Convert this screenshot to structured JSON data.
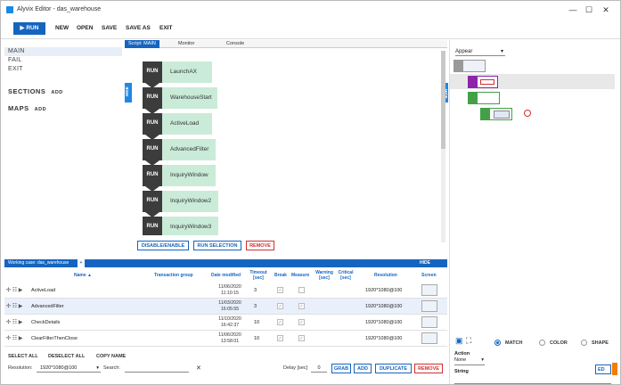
{
  "window": {
    "title": "Alyvix Editor - das_warehouse",
    "controls": [
      "—",
      "☐",
      "✕"
    ]
  },
  "toolbar": {
    "run": "RUN",
    "new": "NEW",
    "open": "OPEN",
    "save": "SAVE",
    "save_as": "SAVE AS",
    "exit": "EXIT"
  },
  "nav": {
    "items": [
      "MAIN",
      "FAIL",
      "EXIT"
    ],
    "sections": "SECTIONS",
    "maps": "MAPS",
    "add": "ADD"
  },
  "center": {
    "tabs": [
      "Script: MAIN",
      "Monitor",
      "Console"
    ],
    "hide": "HIDE",
    "run": "RUN",
    "steps": [
      "LaunchAX",
      "WarehouseStart",
      "ActiveLoad",
      "AdvancedFilter",
      "InquiryWindow",
      "InquiryWindow2",
      "InquiryWindow3"
    ],
    "buttons": {
      "disable_enable": "DISABLE/ENABLE",
      "run_selection": "RUN SELECTION",
      "remove": "REMOVE"
    }
  },
  "testcases": {
    "header_label": "Working case: das_warehouse",
    "plus": "+",
    "hide": "HIDE",
    "columns": {
      "name": "Name ▲",
      "group": "Transaction group",
      "modified": "Date modified",
      "timeout": "Timeout [sec]",
      "break": "Break",
      "measure": "Measure",
      "warning": "Warning [sec]",
      "critical": "Critical [sec]",
      "resolution": "Resolution",
      "screen": "Screen"
    },
    "rows": [
      {
        "name": "ActiveLoad",
        "date": "11/06/2020",
        "time": "11:10:15",
        "timeout": "3",
        "resolution": "1920*1080@100"
      },
      {
        "name": "AdvancedFilter",
        "date": "11/03/2020",
        "time": "16:05:55",
        "timeout": "3",
        "resolution": "1920*1080@100"
      },
      {
        "name": "CheckDetails",
        "date": "11/10/2020",
        "time": "16:42:37",
        "timeout": "10",
        "resolution": "1920*1080@100"
      },
      {
        "name": "ClearFilterThenClose",
        "date": "11/06/2020",
        "time": "13:58:01",
        "timeout": "10",
        "resolution": "1920*1080@100"
      }
    ],
    "actions": {
      "select_all": "SELECT ALL",
      "deselect_all": "DESELECT ALL",
      "copy_name": "COPY NAME"
    },
    "resolution_label": "Resolution:",
    "resolution_value": "1920*1080@100",
    "search_label": "Search:",
    "clear": "✕",
    "delay_label": "Delay [sec]",
    "delay_value": "0",
    "grab": "GRAB",
    "add": "ADD",
    "duplicate": "DUPLICATE",
    "remove": "REMOVE"
  },
  "right": {
    "appear": "Appear",
    "match": "MATCH",
    "color": "COLOR",
    "shape": "SHAPE",
    "action_label": "Action",
    "action_value": "None",
    "string_label": "String",
    "edit_btn": "ED"
  },
  "colors": {
    "accent": "#1565c0",
    "step_label": "#c9ebd8",
    "danger": "#d32f2f"
  }
}
